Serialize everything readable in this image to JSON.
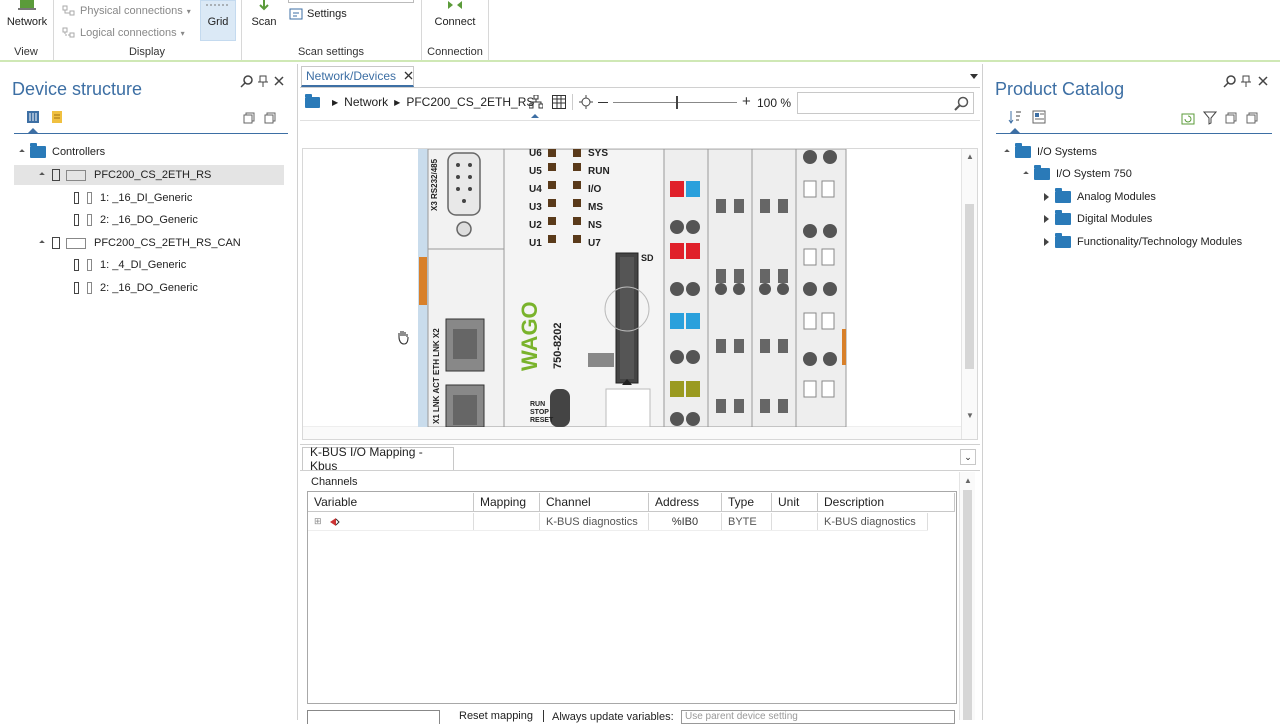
{
  "ribbon": {
    "network_label": "Network",
    "view_group": "View",
    "physical_connections": "Physical connections",
    "logical_connections": "Logical connections",
    "grid_label": "Grid",
    "display_group": "Display",
    "scan_label": "Scan",
    "settings_label": "Settings",
    "scan_settings_group": "Scan settings",
    "connect_label": "Connect",
    "connection_group": "Connection"
  },
  "device_structure": {
    "title": "Device structure",
    "items": [
      {
        "label": "Controllers"
      },
      {
        "label": "PFC200_CS_2ETH_RS"
      },
      {
        "label": "1: _16_DI_Generic"
      },
      {
        "label": "2: _16_DO_Generic"
      },
      {
        "label": "PFC200_CS_2ETH_RS_CAN"
      },
      {
        "label": "1: _4_DI_Generic"
      },
      {
        "label": "2: _16_DO_Generic"
      }
    ]
  },
  "editor": {
    "tab_label": "Network/Devices",
    "breadcrumb_root": "Network",
    "breadcrumb_device": "PFC200_CS_2ETH_RS",
    "zoom_text": "100 %",
    "zoom_level": 0.52,
    "search_placeholder": ""
  },
  "device_image": {
    "port_label": "X3 RS232/485",
    "u_leds": [
      "U6",
      "U5",
      "U4",
      "U3",
      "U2",
      "U1"
    ],
    "status_leds": [
      "SYS",
      "RUN",
      "I/O",
      "MS",
      "NS",
      "U7"
    ],
    "sd_label": "SD",
    "brand": "WAGO",
    "model": "750-8202",
    "eth_label": "X1 LNK ACT ETH LNK X2",
    "switch_label": "RUN STOP RESET"
  },
  "kbus": {
    "tab_label": "K-BUS I/O Mapping - Kbus",
    "channels_label": "Channels",
    "columns": [
      "Variable",
      "Mapping",
      "Channel",
      "Address",
      "Type",
      "Unit",
      "Description"
    ],
    "rows": [
      {
        "variable": "",
        "mapping": "",
        "channel": "K-BUS diagnostics",
        "address": "%IB0",
        "type": "BYTE",
        "unit": "",
        "description": "K-BUS diagnostics"
      }
    ],
    "reset_mapping": "Reset mapping",
    "always_update": "Always update variables:",
    "always_update_value": "Use parent device setting"
  },
  "product_catalog": {
    "title": "Product Catalog",
    "items": [
      {
        "label": "I/O Systems"
      },
      {
        "label": "I/O System 750"
      },
      {
        "label": "Analog Modules"
      },
      {
        "label": "Digital Modules"
      },
      {
        "label": "Functionality/Technology Modules"
      }
    ]
  },
  "colors": {
    "accent": "#3d6fa4",
    "ribbon_line": "#8fc15a",
    "folder": "#2a7ab8",
    "wago_green": "#79b32b"
  }
}
